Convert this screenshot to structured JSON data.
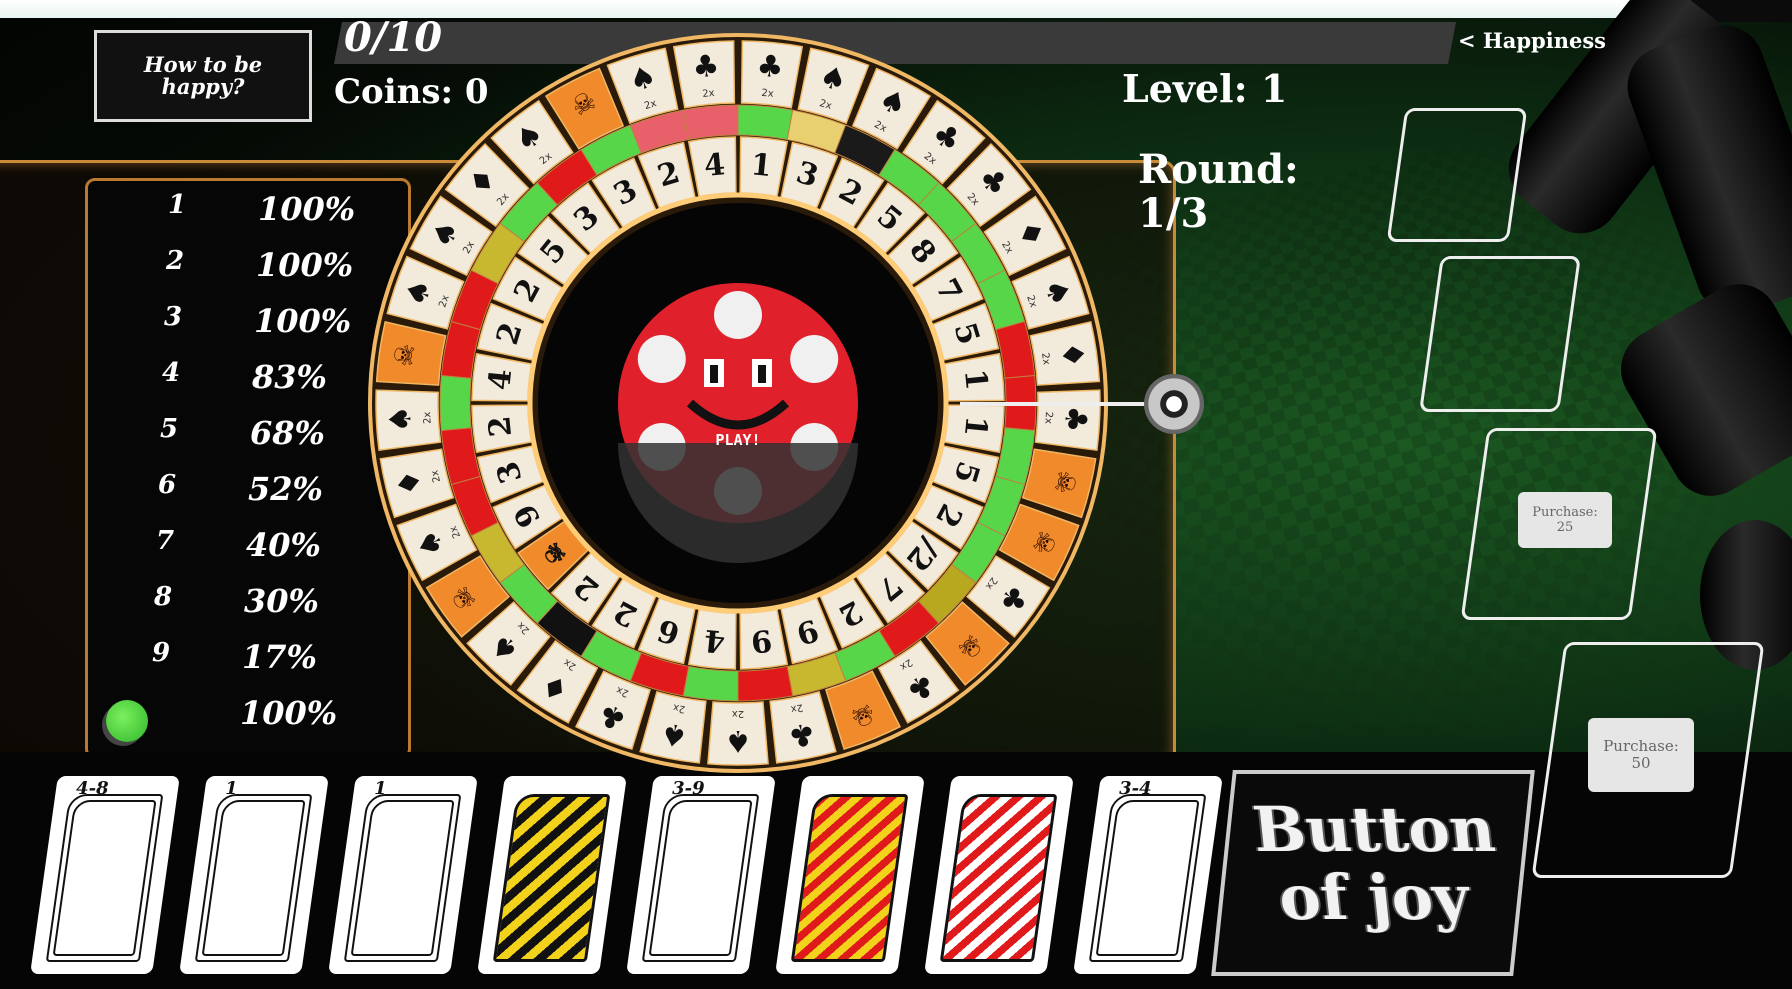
{
  "header": {
    "howto_label": "How to be happy?",
    "progress_text": "0/10",
    "progress_fraction": 0.0,
    "happiness_link": "< Happiness",
    "coins_text": "Coins: 0",
    "level_text": "Level: 1",
    "round_label": "Round:",
    "round_value": "1/3"
  },
  "odds_table": [
    {
      "n": "1",
      "p": "100%"
    },
    {
      "n": "2",
      "p": "100%"
    },
    {
      "n": "3",
      "p": "100%"
    },
    {
      "n": "4",
      "p": "83%"
    },
    {
      "n": "5",
      "p": "68%"
    },
    {
      "n": "6",
      "p": "52%"
    },
    {
      "n": "7",
      "p": "40%"
    },
    {
      "n": "8",
      "p": "30%"
    },
    {
      "n": "9",
      "p": "17%"
    },
    {
      "n": "green",
      "p": "100%"
    }
  ],
  "wheel": {
    "play_label": "PLAY!",
    "outer": [
      "♣",
      "♠",
      "♠",
      "♣",
      "♣",
      "♦",
      "♠",
      "♦",
      "♣",
      "skull",
      "skull",
      "♣",
      "skull",
      "♣",
      "skull",
      "♣",
      "♠",
      "♠",
      "♣",
      "♦",
      "♠",
      "skull",
      "♠",
      "♦",
      "♠",
      "skull",
      "♠",
      "♠",
      "♦",
      "♠",
      "skull",
      "♠",
      "♣"
    ],
    "outer_multiplier": "2x",
    "middle_colors": [
      "#57d64a",
      "#e8d070",
      "#1a1a1a",
      "#57d64a",
      "#57d64a",
      "#57d64a",
      "#57d64a",
      "#e01a1a",
      "#e01a1a",
      "#57d64a",
      "#57d64a",
      "#57d64a",
      "#b8a820",
      "#e01a1a",
      "#57d64a",
      "#c8b830",
      "#e01a1a",
      "#57d64a",
      "#e01a1a",
      "#57d64a",
      "#111111",
      "#57d64a",
      "#c8b830",
      "#e01a1a",
      "#e01a1a",
      "#57d64a",
      "#e01a1a",
      "#e01a1a",
      "#c8b830",
      "#57d64a",
      "#e01a1a",
      "#57d64a",
      "#e8606a",
      "#e8606a"
    ],
    "inner": [
      "1",
      "3",
      "2",
      "5",
      "8",
      "7",
      "5",
      "1",
      "1",
      "5",
      "2",
      "/2",
      "7",
      "2",
      "9",
      "9",
      "4",
      "6",
      "2",
      "2",
      "skull",
      "9",
      "3",
      "2",
      "4",
      "2",
      "2",
      "5",
      "3",
      "3",
      "2",
      "4"
    ]
  },
  "mascot": {
    "name": "smiling-chip",
    "color": "#e0202a"
  },
  "shop": {
    "purchase_1": {
      "label": "Purchase:",
      "price": "25"
    },
    "purchase_2": {
      "label": "Purchase:",
      "price": "50"
    }
  },
  "hand": [
    {
      "label": "4-8",
      "style": "plain"
    },
    {
      "label": "1",
      "style": "plain"
    },
    {
      "label": "1",
      "style": "plain"
    },
    {
      "label": "",
      "style": "yellow"
    },
    {
      "label": "3-9",
      "style": "plain"
    },
    {
      "label": "",
      "style": "redyellow"
    },
    {
      "label": "",
      "style": "redwhite"
    },
    {
      "label": "3-4",
      "style": "plain"
    }
  ],
  "joy_button": {
    "line1": "Button",
    "line2": "of joy"
  },
  "colors": {
    "accent_green": "#57d64a",
    "accent_red": "#e01a1a",
    "accent_orange": "#f08a2a",
    "gold": "#e8b05a",
    "felt": "#1c5a22"
  }
}
